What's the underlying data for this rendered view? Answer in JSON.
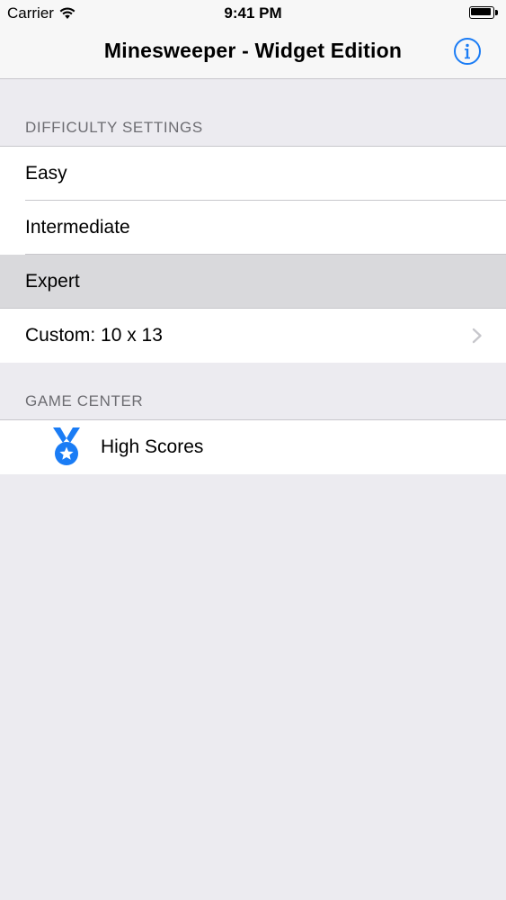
{
  "status_bar": {
    "carrier": "Carrier",
    "time": "9:41 PM",
    "wifi_icon": "wifi-icon",
    "battery_icon": "battery-icon"
  },
  "nav": {
    "title": "Minesweeper - Widget Edition",
    "info_icon": "info-icon",
    "accent_color": "#1A7CF5"
  },
  "sections": {
    "difficulty": {
      "header": "DIFFICULTY SETTINGS",
      "items": [
        {
          "label": "Easy",
          "selected": false
        },
        {
          "label": "Intermediate",
          "selected": false
        },
        {
          "label": "Expert",
          "selected": true
        },
        {
          "label": "Custom: 10 x 13",
          "selected": false,
          "disclosure": "chevron-right-icon"
        }
      ]
    },
    "game_center": {
      "header": "GAME CENTER",
      "items": [
        {
          "label": "High Scores",
          "icon": "medal-icon"
        }
      ]
    }
  },
  "colors": {
    "background": "#ECEBF0",
    "cell_background": "#FFFFFF",
    "selected_background": "#D9D9DC",
    "separator": "#C8C7CC",
    "section_header": "#6D6D72",
    "medal": "#1A7CF5"
  }
}
